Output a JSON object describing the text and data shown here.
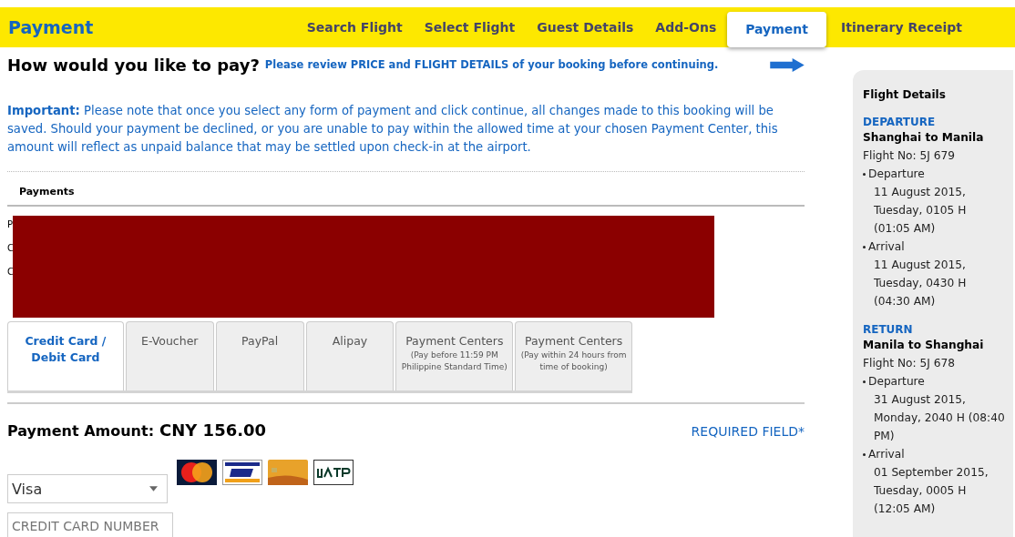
{
  "header": {
    "title": "Payment",
    "steps": [
      {
        "label": "Search Flight",
        "selected": false
      },
      {
        "label": "Select Flight",
        "selected": false
      },
      {
        "label": "Guest Details",
        "selected": false
      },
      {
        "label": "Add-Ons",
        "selected": false
      },
      {
        "label": "Payment",
        "selected": true
      },
      {
        "label": "Itinerary Receipt",
        "selected": false
      }
    ]
  },
  "heading": "How would you like to pay?",
  "review_note": "Please review PRICE and FLIGHT DETAILS of your booking before continuing.",
  "important": "**Important:** Please note that once you select any form of payment and click continue, all changes made to this booking will be saved. Should your payment be declined, or you are unable to pay within the allowed time at your chosen Payment Center, this amount will reflect as unpaid balance that may be settled upon check-in at the airport.",
  "payments_label": "Payments",
  "redacted_rows": [
    "P",
    "C",
    "C"
  ],
  "payment_tabs": [
    {
      "label": "Credit Card / Debit Card",
      "selected": true
    },
    {
      "label": "E-Voucher",
      "selected": false
    },
    {
      "label": "PayPal",
      "selected": false
    },
    {
      "label": "Alipay",
      "selected": false
    },
    {
      "label": "Payment Centers",
      "note": "(Pay before 11:59 PM Philippine Standard Time)",
      "selected": false
    },
    {
      "label": "Payment Centers",
      "note": "(Pay within 24 hours from time of booking)",
      "selected": false
    }
  ],
  "amount_label": "Payment Amount:",
  "amount": "CNY 156.00",
  "required": "REQUIRED FIELD*",
  "card_type": {
    "value": "Visa"
  },
  "card_logos": [
    {
      "kind": "mastercard"
    },
    {
      "kind": "visa"
    },
    {
      "kind": "bankcard"
    },
    {
      "kind": "uatp"
    }
  ],
  "card_number": {
    "placeholder": "CREDIT CARD NUMBER"
  },
  "sidebar": {
    "title": "Flight Details",
    "legs": [
      {
        "direction": "DEPARTURE",
        "route": "Shanghai to Manila",
        "flight_no": "Flight No: 5J 679",
        "events": [
          {
            "label": "Departure",
            "lines": [
              "11 August 2015,",
              "Tuesday, 0105 H",
              "(01:05 AM)"
            ]
          },
          {
            "label": "Arrival",
            "lines": [
              "11 August 2015,",
              "Tuesday, 0430 H",
              "(04:30 AM)"
            ]
          }
        ]
      },
      {
        "direction": "RETURN",
        "route": "Manila to Shanghai",
        "flight_no": "Flight No: 5J 678",
        "events": [
          {
            "label": "Departure",
            "lines": [
              "31 August 2015,",
              "Monday, 2040 H (08:40",
              "PM)"
            ]
          },
          {
            "label": "Arrival",
            "lines": [
              "01 September 2015,",
              "Tuesday, 0005 H",
              "(12:05 AM)"
            ]
          }
        ]
      }
    ]
  }
}
